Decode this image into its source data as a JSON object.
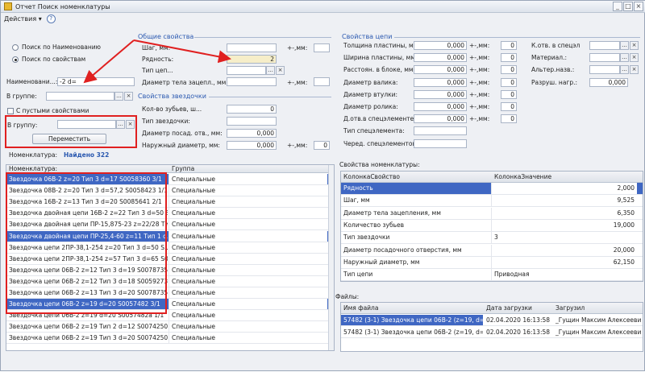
{
  "window": {
    "title": "Отчет  Поиск номенклатуры",
    "minimize": "_",
    "restore": "□",
    "close": "×"
  },
  "toolbar": {
    "actions_label": "Действия ▾",
    "help": "?"
  },
  "search": {
    "by_name": "Поиск по Наименованию",
    "by_props": "Поиск по свойствам",
    "name_label": "Наименовани...:",
    "name_value": "-2 d=",
    "in_group_label": "В группе:",
    "empty_props_label": "С пустыми свойствами",
    "to_group_label": "В группу:",
    "move_button": "Переместить"
  },
  "general": {
    "title": "Общие свойства",
    "rows": [
      {
        "label": "Шаг, мм:",
        "value": "",
        "pm": "+-,мм:",
        "pmv": ""
      },
      {
        "label": "Рядность:",
        "value": "2"
      },
      {
        "label": "Тип цеп...",
        "value": ""
      },
      {
        "label": "Диаметр тела зацепл., мм:",
        "value": "",
        "pm": "+-,мм:",
        "pmv": ""
      }
    ]
  },
  "sprocket": {
    "title": "Свойства звездочки",
    "rows": [
      {
        "label": "Кол-во зубьев, ш...",
        "value": "0"
      },
      {
        "label": "Тип звездочки:",
        "value": ""
      },
      {
        "label": "Диаметр посад. отв., мм:",
        "value": "0,000"
      },
      {
        "label": "Наружный диаметр, мм:",
        "value": "0,000",
        "pm": "+-,мм:",
        "pmv": "0"
      }
    ]
  },
  "chain": {
    "title": "Свойства цепи",
    "rows": [
      {
        "label": "Толщина пластины, мм:",
        "value": "0,000",
        "pm": "+-,мм:",
        "pmv": "0"
      },
      {
        "label": "Ширина пластины, мм:",
        "value": "0,000",
        "pm": "+-,мм:",
        "pmv": "0"
      },
      {
        "label": "Расстоян. в блоке, мм:",
        "value": "0,000",
        "pm": "+-,мм:",
        "pmv": "0"
      },
      {
        "label": "Диаметр валика:",
        "value": "0,000",
        "pm": "+-,мм:",
        "pmv": "0"
      },
      {
        "label": "Диаметр втулки:",
        "value": "0,000",
        "pm": "+-,мм:",
        "pmv": "0"
      },
      {
        "label": "Диаметр ролика:",
        "value": "0,000",
        "pm": "+-,мм:",
        "pmv": "0"
      },
      {
        "label": "Д.отв.в спецэлементе:",
        "value": "0,000",
        "pm": "+-,мм:",
        "pmv": "0"
      },
      {
        "label": "Тип спецэлемента:",
        "value": ""
      },
      {
        "label": "Черед. спецэлементов:",
        "value": ""
      }
    ],
    "right": [
      {
        "label": "К.отв. в спецэл",
        "value": ""
      },
      {
        "label": "Материал.:",
        "value": ""
      },
      {
        "label": "Альтер.назв.:",
        "value": ""
      },
      {
        "label": "Разруш. нагр.:",
        "value": "0,000"
      }
    ]
  },
  "results": {
    "label": "Номенклатура:",
    "found": "Найдено 322",
    "col_name": "Номенклатура:",
    "col_group": "Группа",
    "rows": [
      {
        "name": "Звездочка 06B-2 z=20 Тип 3 d=17 S0058360 3/1",
        "group": "Специальные",
        "sel": true
      },
      {
        "name": "Звездочка 08B-2 z=20 Тип 3 d=57,2 S0058423 1/1",
        "group": "Специальные",
        "sel": false
      },
      {
        "name": "Звездочка 16B-2 z=13 Тип 3 d=20 S0085641 2/1",
        "group": "Специальные",
        "sel": false
      },
      {
        "name": "Звездочка двойная цепи 16B-2 z=22 Тип 3 d=50 S...",
        "group": "Специальные",
        "sel": false
      },
      {
        "name": "Звездочка двойная цепи ПР-15,875-23 z=22/28 Ти...",
        "group": "Специальные",
        "sel": false
      },
      {
        "name": "Звездочка двойная цепи ПР-25,4-60 z=11 Тип 1 d...",
        "group": "Специальные",
        "sel": true
      },
      {
        "name": "Звездочка цепи 2ПР-38,1-254 z=20 Тип 3 d=50 S...",
        "group": "Специальные",
        "sel": false
      },
      {
        "name": "Звездочка цепи 2ПР-38,1-254 z=57 Тип 3 d=65 S0...",
        "group": "Специальные",
        "sel": false
      },
      {
        "name": "Звездочка цепи 06B-2 z=12 Тип 3 d=19 S0078735 ...",
        "group": "Специальные",
        "sel": false
      },
      {
        "name": "Звездочка цепи 06B-2 z=12 Тип 3 d=18 S0059273 ...",
        "group": "Специальные",
        "sel": false
      },
      {
        "name": "Звездочка цепи 06B-2 z=13 Тип 3 d=20 S0078735 ...",
        "group": "Специальные",
        "sel": false
      },
      {
        "name": "Звездочка цепи 06B-2 z=19 d=20 S0057482 3/1",
        "group": "Специальные",
        "sel": true
      },
      {
        "name": "Звездочка цепи 06B-2 z=19 d=20 S0057482a 1/1",
        "group": "Специальные",
        "sel": false
      },
      {
        "name": "Звездочка цепи 06B-2 z=19 Тип 2 d=12 S0074250 ...",
        "group": "Специальные",
        "sel": false
      },
      {
        "name": "Звездочка цепи 06B-2 z=19 Тип 3 d=20 S0074250 ...",
        "group": "Специальные",
        "sel": false
      }
    ]
  },
  "props": {
    "title": "Свойства номенклатуры:",
    "col_prop": "КолонкаСвойство",
    "col_val": "КолонкаЗначение",
    "rows": [
      {
        "p": "Рядность",
        "v": "2,000",
        "sel": true
      },
      {
        "p": "Шаг, мм",
        "v": "9,525",
        "sel": false
      },
      {
        "p": "Диаметр тела зацепления, мм",
        "v": "6,350",
        "sel": false
      },
      {
        "p": "Количество зубьев",
        "v": "19,000",
        "sel": false
      },
      {
        "p": "Тип звездочки",
        "v": "3",
        "sel": false,
        "left": true
      },
      {
        "p": "Диаметр посадочного отверстия, мм",
        "v": "20,000",
        "sel": false
      },
      {
        "p": "Наружный диаметр, мм",
        "v": "62,150",
        "sel": false
      },
      {
        "p": "Тип цепи",
        "v": "Приводная",
        "sel": false,
        "left": true
      }
    ]
  },
  "files": {
    "title": "Файлы:",
    "col_name": "Имя файла",
    "col_date": "Дата загрузки",
    "col_user": "Загрузил",
    "rows": [
      {
        "name": "57482 (3-1) Звездочка цепи 06B-2 (z=19, d=2...",
        "date": "02.04.2020 16:13:58",
        "user": "_Гущин Максим Алексееви",
        "sel": true
      },
      {
        "name": "57482 (3-1) Звездочка цепи 06B-2 (z=19, d=2...",
        "date": "02.04.2020 16:13:58",
        "user": "_Гущин Максим Алексееви",
        "sel": false
      }
    ]
  },
  "colors": {
    "selection": "#3f67c3",
    "highlight": "#f6eec9",
    "annotation_red": "#e02020",
    "section_blue": "#2b59b0"
  }
}
